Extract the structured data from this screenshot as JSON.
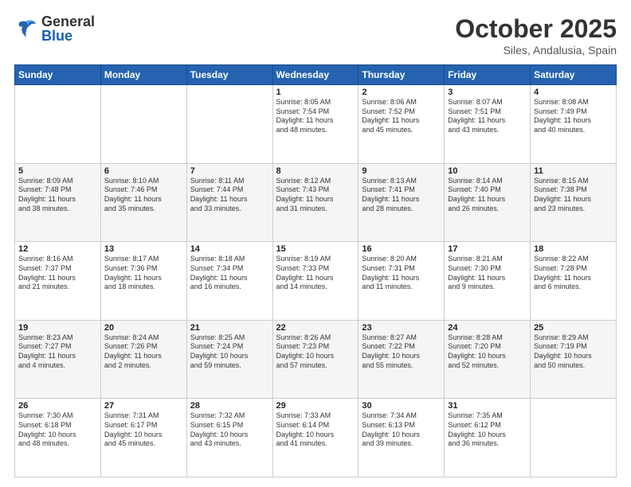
{
  "header": {
    "logo_general": "General",
    "logo_blue": "Blue",
    "title": "October 2025",
    "location": "Siles, Andalusia, Spain"
  },
  "days_of_week": [
    "Sunday",
    "Monday",
    "Tuesday",
    "Wednesday",
    "Thursday",
    "Friday",
    "Saturday"
  ],
  "weeks": [
    [
      {
        "day": "",
        "info": ""
      },
      {
        "day": "",
        "info": ""
      },
      {
        "day": "",
        "info": ""
      },
      {
        "day": "1",
        "info": "Sunrise: 8:05 AM\nSunset: 7:54 PM\nDaylight: 11 hours\nand 48 minutes."
      },
      {
        "day": "2",
        "info": "Sunrise: 8:06 AM\nSunset: 7:52 PM\nDaylight: 11 hours\nand 45 minutes."
      },
      {
        "day": "3",
        "info": "Sunrise: 8:07 AM\nSunset: 7:51 PM\nDaylight: 11 hours\nand 43 minutes."
      },
      {
        "day": "4",
        "info": "Sunrise: 8:08 AM\nSunset: 7:49 PM\nDaylight: 11 hours\nand 40 minutes."
      }
    ],
    [
      {
        "day": "5",
        "info": "Sunrise: 8:09 AM\nSunset: 7:48 PM\nDaylight: 11 hours\nand 38 minutes."
      },
      {
        "day": "6",
        "info": "Sunrise: 8:10 AM\nSunset: 7:46 PM\nDaylight: 11 hours\nand 35 minutes."
      },
      {
        "day": "7",
        "info": "Sunrise: 8:11 AM\nSunset: 7:44 PM\nDaylight: 11 hours\nand 33 minutes."
      },
      {
        "day": "8",
        "info": "Sunrise: 8:12 AM\nSunset: 7:43 PM\nDaylight: 11 hours\nand 31 minutes."
      },
      {
        "day": "9",
        "info": "Sunrise: 8:13 AM\nSunset: 7:41 PM\nDaylight: 11 hours\nand 28 minutes."
      },
      {
        "day": "10",
        "info": "Sunrise: 8:14 AM\nSunset: 7:40 PM\nDaylight: 11 hours\nand 26 minutes."
      },
      {
        "day": "11",
        "info": "Sunrise: 8:15 AM\nSunset: 7:38 PM\nDaylight: 11 hours\nand 23 minutes."
      }
    ],
    [
      {
        "day": "12",
        "info": "Sunrise: 8:16 AM\nSunset: 7:37 PM\nDaylight: 11 hours\nand 21 minutes."
      },
      {
        "day": "13",
        "info": "Sunrise: 8:17 AM\nSunset: 7:36 PM\nDaylight: 11 hours\nand 18 minutes."
      },
      {
        "day": "14",
        "info": "Sunrise: 8:18 AM\nSunset: 7:34 PM\nDaylight: 11 hours\nand 16 minutes."
      },
      {
        "day": "15",
        "info": "Sunrise: 8:19 AM\nSunset: 7:33 PM\nDaylight: 11 hours\nand 14 minutes."
      },
      {
        "day": "16",
        "info": "Sunrise: 8:20 AM\nSunset: 7:31 PM\nDaylight: 11 hours\nand 11 minutes."
      },
      {
        "day": "17",
        "info": "Sunrise: 8:21 AM\nSunset: 7:30 PM\nDaylight: 11 hours\nand 9 minutes."
      },
      {
        "day": "18",
        "info": "Sunrise: 8:22 AM\nSunset: 7:28 PM\nDaylight: 11 hours\nand 6 minutes."
      }
    ],
    [
      {
        "day": "19",
        "info": "Sunrise: 8:23 AM\nSunset: 7:27 PM\nDaylight: 11 hours\nand 4 minutes."
      },
      {
        "day": "20",
        "info": "Sunrise: 8:24 AM\nSunset: 7:26 PM\nDaylight: 11 hours\nand 2 minutes."
      },
      {
        "day": "21",
        "info": "Sunrise: 8:25 AM\nSunset: 7:24 PM\nDaylight: 10 hours\nand 59 minutes."
      },
      {
        "day": "22",
        "info": "Sunrise: 8:26 AM\nSunset: 7:23 PM\nDaylight: 10 hours\nand 57 minutes."
      },
      {
        "day": "23",
        "info": "Sunrise: 8:27 AM\nSunset: 7:22 PM\nDaylight: 10 hours\nand 55 minutes."
      },
      {
        "day": "24",
        "info": "Sunrise: 8:28 AM\nSunset: 7:20 PM\nDaylight: 10 hours\nand 52 minutes."
      },
      {
        "day": "25",
        "info": "Sunrise: 8:29 AM\nSunset: 7:19 PM\nDaylight: 10 hours\nand 50 minutes."
      }
    ],
    [
      {
        "day": "26",
        "info": "Sunrise: 7:30 AM\nSunset: 6:18 PM\nDaylight: 10 hours\nand 48 minutes."
      },
      {
        "day": "27",
        "info": "Sunrise: 7:31 AM\nSunset: 6:17 PM\nDaylight: 10 hours\nand 45 minutes."
      },
      {
        "day": "28",
        "info": "Sunrise: 7:32 AM\nSunset: 6:15 PM\nDaylight: 10 hours\nand 43 minutes."
      },
      {
        "day": "29",
        "info": "Sunrise: 7:33 AM\nSunset: 6:14 PM\nDaylight: 10 hours\nand 41 minutes."
      },
      {
        "day": "30",
        "info": "Sunrise: 7:34 AM\nSunset: 6:13 PM\nDaylight: 10 hours\nand 39 minutes."
      },
      {
        "day": "31",
        "info": "Sunrise: 7:35 AM\nSunset: 6:12 PM\nDaylight: 10 hours\nand 36 minutes."
      },
      {
        "day": "",
        "info": ""
      }
    ]
  ]
}
